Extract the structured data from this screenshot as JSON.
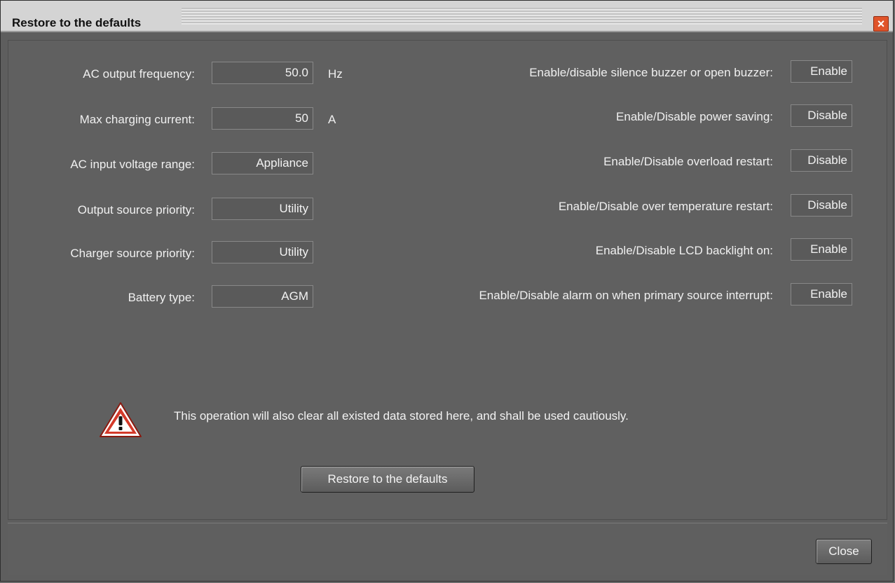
{
  "window": {
    "title": "Restore to the defaults"
  },
  "left_settings": [
    {
      "label": "AC output frequency:",
      "value": "50.0",
      "unit": "Hz"
    },
    {
      "label": "Max charging current:",
      "value": "50",
      "unit": "A"
    },
    {
      "label": "AC input voltage range:",
      "value": "Appliance",
      "unit": ""
    },
    {
      "label": "Output source priority:",
      "value": "Utility",
      "unit": ""
    },
    {
      "label": "Charger source priority:",
      "value": "Utility",
      "unit": ""
    },
    {
      "label": "Battery type:",
      "value": "AGM",
      "unit": ""
    }
  ],
  "right_settings": [
    {
      "label": "Enable/disable silence buzzer or open buzzer:",
      "value": "Enable"
    },
    {
      "label": "Enable/Disable power saving:",
      "value": "Disable"
    },
    {
      "label": "Enable/Disable overload restart:",
      "value": "Disable"
    },
    {
      "label": "Enable/Disable over temperature restart:",
      "value": "Disable"
    },
    {
      "label": "Enable/Disable LCD backlight on:",
      "value": "Enable"
    },
    {
      "label": "Enable/Disable alarm on when primary source interrupt:",
      "value": "Enable"
    }
  ],
  "warning": {
    "text": "This operation will also clear all existed data stored here, and shall be used cautiously.",
    "icon": "warning-triangle-icon"
  },
  "buttons": {
    "restore": "Restore to the defaults",
    "close": "Close"
  },
  "colors": {
    "background": "#606060",
    "text": "#f0f0f0",
    "warning_red": "#d43a2a"
  }
}
